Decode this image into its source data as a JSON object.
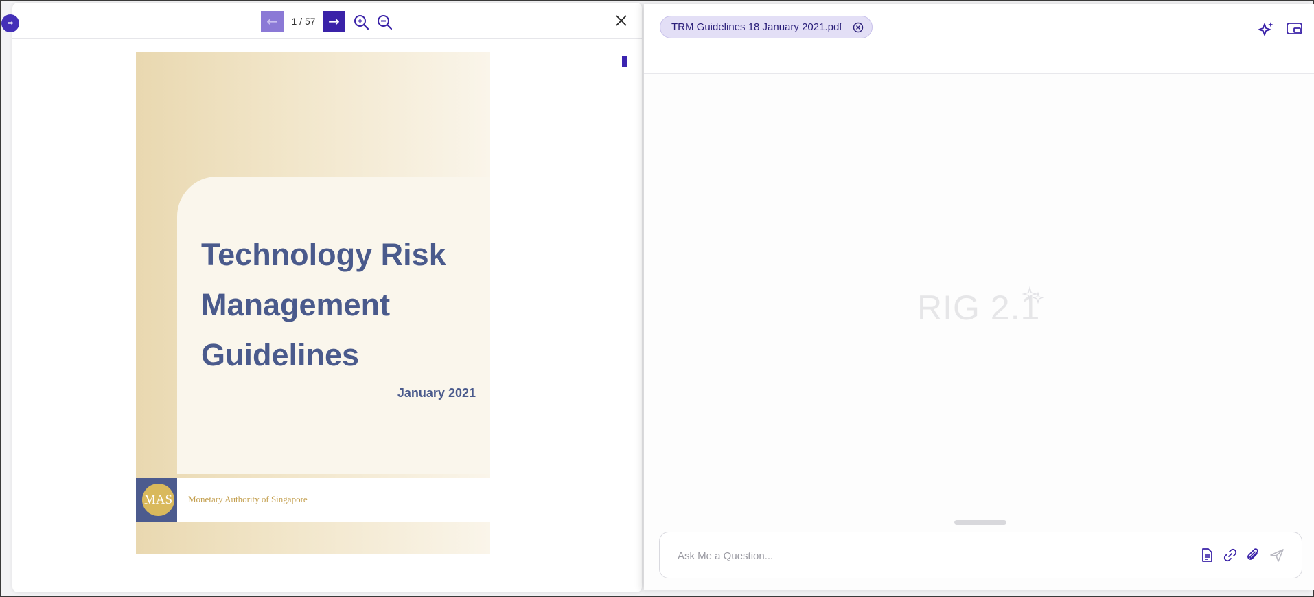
{
  "viewer": {
    "prev_label": "←",
    "next_label": "→",
    "page_counter": "1 / 57",
    "icons": [
      "zoom-in-icon",
      "zoom-out-icon",
      "close-icon"
    ]
  },
  "pdf": {
    "title_line1": "Technology Risk",
    "title_line2": "Management",
    "title_line3": "Guidelines",
    "date": "January 2021",
    "logo_text": "MAS",
    "org_name": "Monetary Authority of Singapore"
  },
  "chat": {
    "file_chip": "TRM Guidelines 18 January 2021.pdf",
    "brand": "RIG 2.1",
    "input_placeholder": "Ask Me a Question...",
    "icons": [
      "sparkle-icon",
      "screen-icon",
      "document-icon",
      "link-icon",
      "paperclip-icon",
      "send-icon"
    ]
  },
  "colors": {
    "accent": "#3a22a8",
    "accent_disabled": "#8b79d6",
    "chip_bg": "#e3dff6",
    "title_blue": "#4a5a8c",
    "gold": "#d9b95c"
  }
}
